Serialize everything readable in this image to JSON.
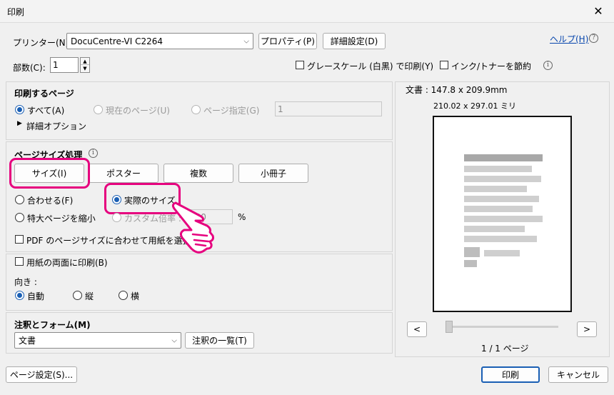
{
  "window": {
    "title": "印刷",
    "close_glyph": "✕"
  },
  "printer": {
    "label": "プリンター(N):",
    "value": "DocuCentre-VI C2264",
    "properties_button": "プロパティ(P)",
    "advanced_button": "詳細設定(D)",
    "help_link": "ヘルプ(H)"
  },
  "copies": {
    "label": "部数(C):",
    "value": "1"
  },
  "options": {
    "grayscale": "グレースケール (白黒) で印刷(Y)",
    "save_ink": "インク/トナーを節約"
  },
  "pages_to_print": {
    "title": "印刷するページ",
    "all": "すべて(A)",
    "current": "現在のページ(U)",
    "range": "ページ指定(G)",
    "range_value": "1",
    "more_options": "詳細オプション"
  },
  "page_sizing": {
    "title": "ページサイズ処理",
    "tabs": [
      "サイズ(I)",
      "ポスター",
      "複数",
      "小冊子"
    ],
    "fit": "合わせる(F)",
    "actual_size": "実際のサイズ",
    "shrink": "特大ページを縮小",
    "custom_scale": "カスタム倍率 :",
    "scale_value": "100",
    "percent": "%",
    "choose_paper": "PDF のページサイズに合わせて用紙を選択(Z)"
  },
  "duplex": {
    "label": "用紙の両面に印刷(B)"
  },
  "orientation": {
    "title": "向き :",
    "auto": "自動",
    "portrait": "縦",
    "landscape": "横"
  },
  "comments_forms": {
    "title": "注釈とフォーム(M)",
    "value": "文書",
    "summary_button": "注釈の一覧(T)"
  },
  "preview": {
    "document_size": "文書 : 147.8 x 209.9mm",
    "paper_size": "210.02 x 297.01 ミリ",
    "prev_button": "<",
    "next_button": ">",
    "page_indicator": "1 / 1 ページ"
  },
  "footer": {
    "page_setup_button": "ページ設定(S)...",
    "print_button": "印刷",
    "cancel_button": "キャンセル"
  },
  "colors": {
    "highlight": "#e6007e",
    "accent": "#1a5fb4"
  }
}
